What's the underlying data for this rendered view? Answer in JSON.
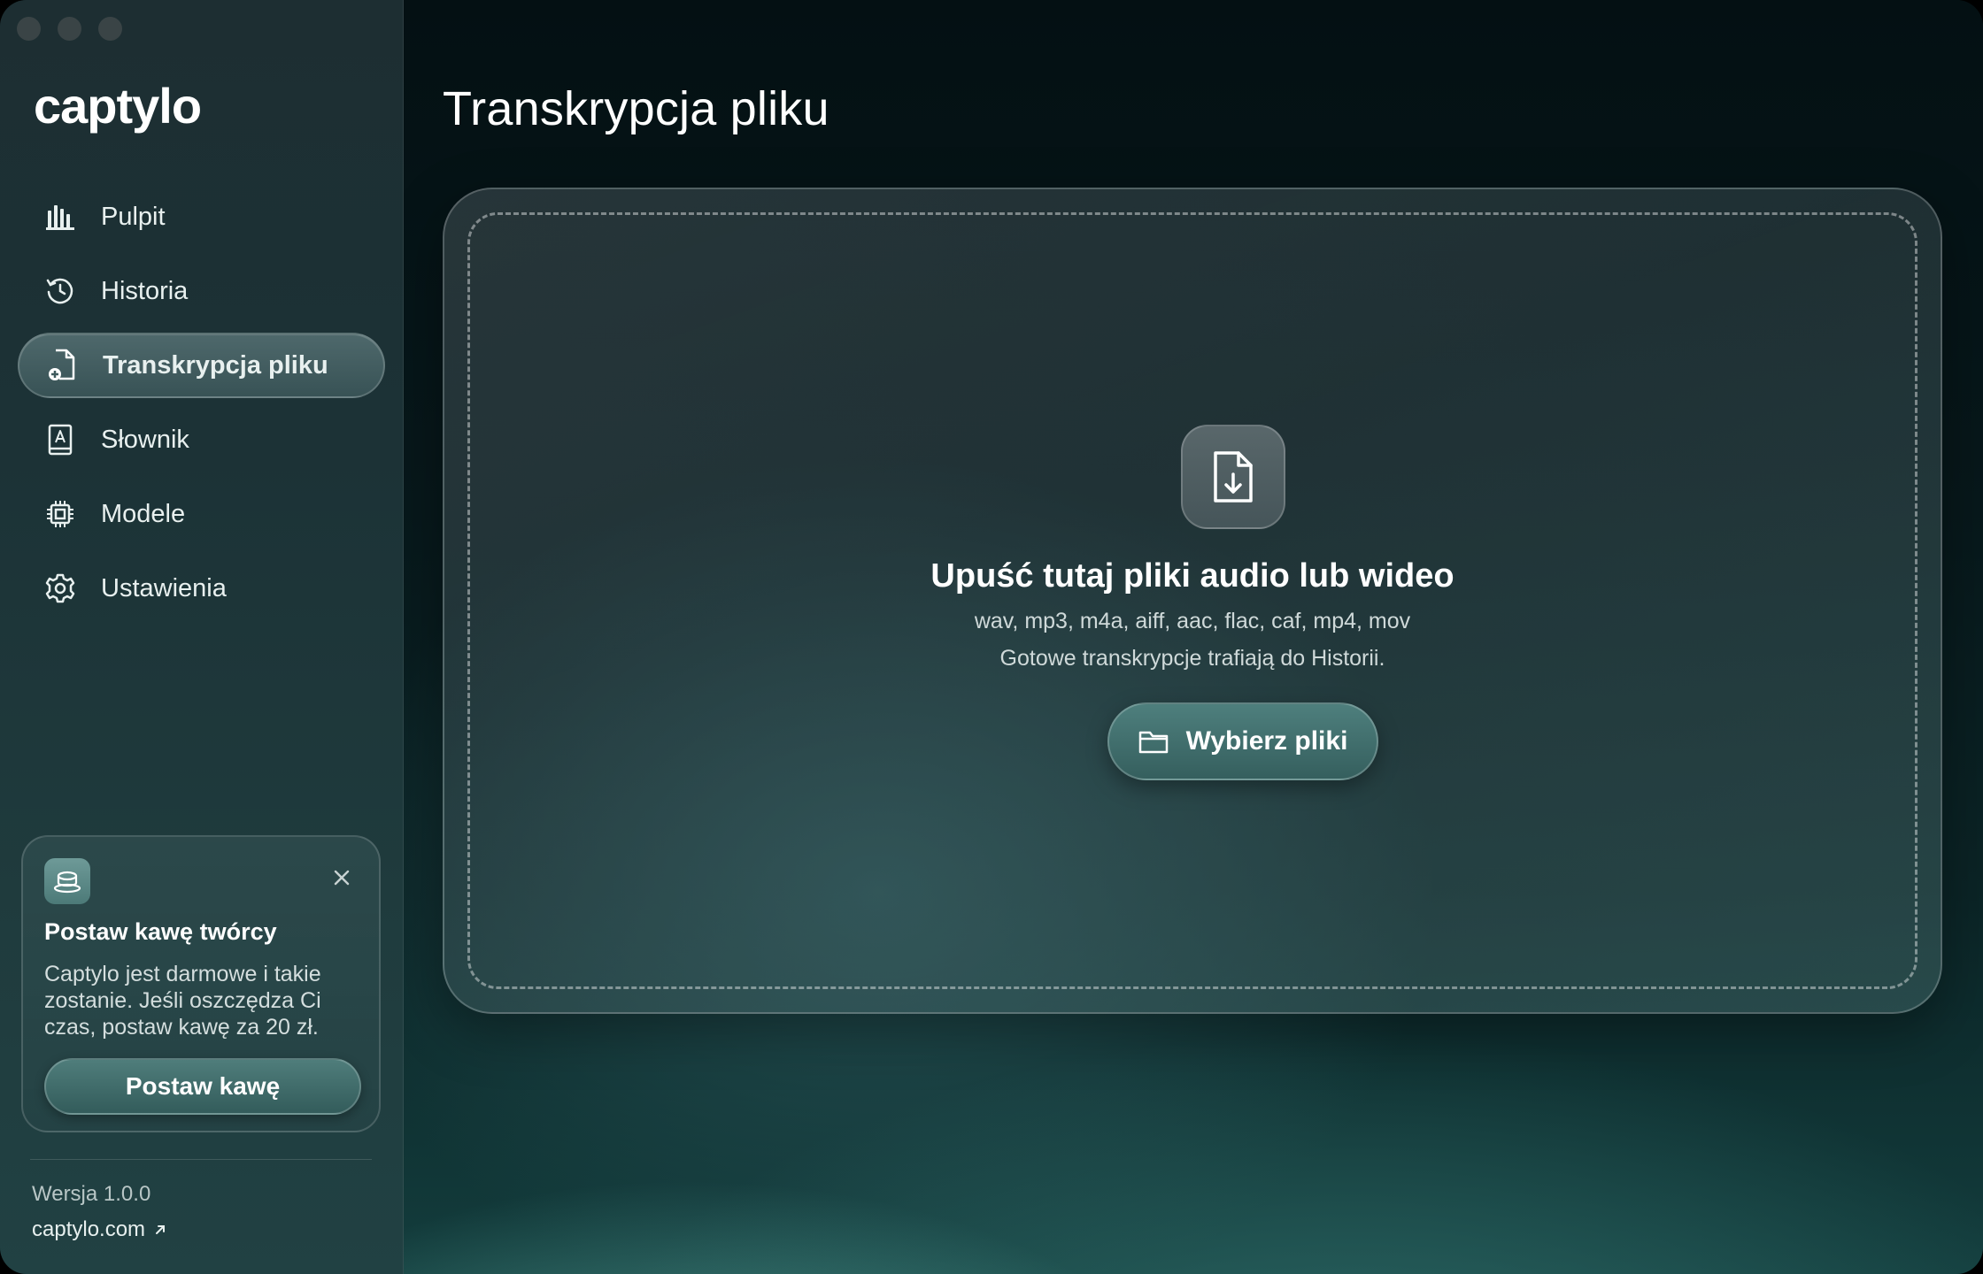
{
  "app": {
    "name": "captylo"
  },
  "sidebar": {
    "items": [
      {
        "label": "Pulpit",
        "icon": "chart-bars-icon"
      },
      {
        "label": "Historia",
        "icon": "history-icon"
      },
      {
        "label": "Transkrypcja pliku",
        "icon": "file-add-icon",
        "active": true
      },
      {
        "label": "Słownik",
        "icon": "dictionary-icon"
      },
      {
        "label": "Modele",
        "icon": "chip-icon"
      },
      {
        "label": "Ustawienia",
        "icon": "gear-icon"
      }
    ],
    "promo": {
      "title": "Postaw kawę twórcy",
      "text": "Captylo jest darmowe i takie zostanie. Jeśli oszczędza Ci czas, postaw kawę za 20 zł.",
      "button": "Postaw kawę"
    },
    "version": "Wersja 1.0.0",
    "site": "captylo.com"
  },
  "main": {
    "title": "Transkrypcja pliku",
    "dropzone": {
      "title": "Upuść tutaj pliki audio lub wideo",
      "formats": "wav, mp3, m4a, aiff, aac, flac, caf, mp4, mov",
      "note": "Gotowe transkrypcje trafiają do Historii.",
      "button": "Wybierz pliki"
    }
  },
  "colors": {
    "accent": "#4e7f7d",
    "background": "#07191b",
    "sidebar": "#1d2e32"
  }
}
